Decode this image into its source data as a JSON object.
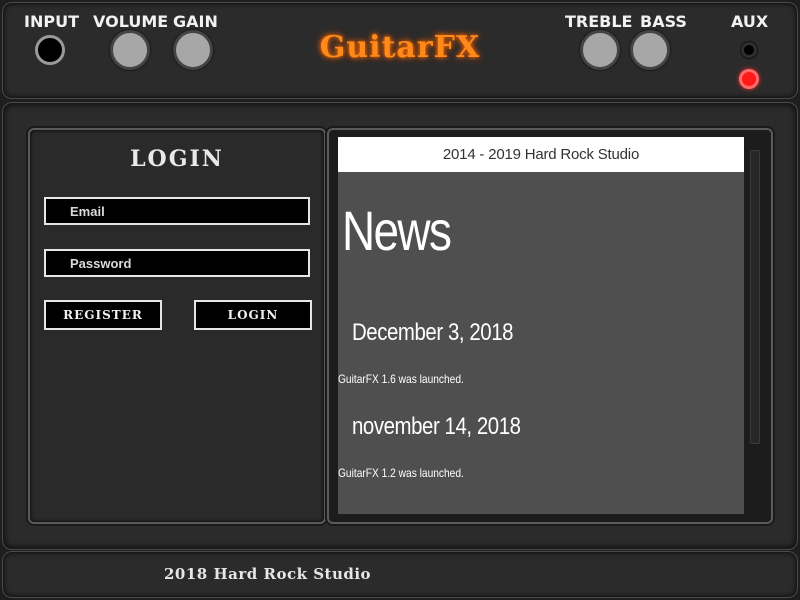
{
  "header": {
    "brand": "GuitarFX",
    "labels": {
      "input": "INPUT",
      "volume": "VOLUME",
      "gain": "GAIN",
      "treble": "TREBLE",
      "bass": "BASS",
      "aux": "AUX"
    },
    "led_color": "#ff1a1a",
    "brand_color": "#ff8a1a"
  },
  "login": {
    "title": "LOGIN",
    "email_placeholder": "Email",
    "password_placeholder": "Password",
    "register_label": "REGISTER",
    "login_label": "LOGIN"
  },
  "news": {
    "header": "2014 - 2019 Hard Rock Studio",
    "title": "News",
    "items": [
      {
        "date": "December 3, 2018",
        "text": "GuitarFX 1.6 was launched."
      },
      {
        "date": "november 14, 2018",
        "text": "GuitarFX 1.2 was launched."
      }
    ]
  },
  "footer": {
    "text": "2018 Hard Rock Studio"
  }
}
